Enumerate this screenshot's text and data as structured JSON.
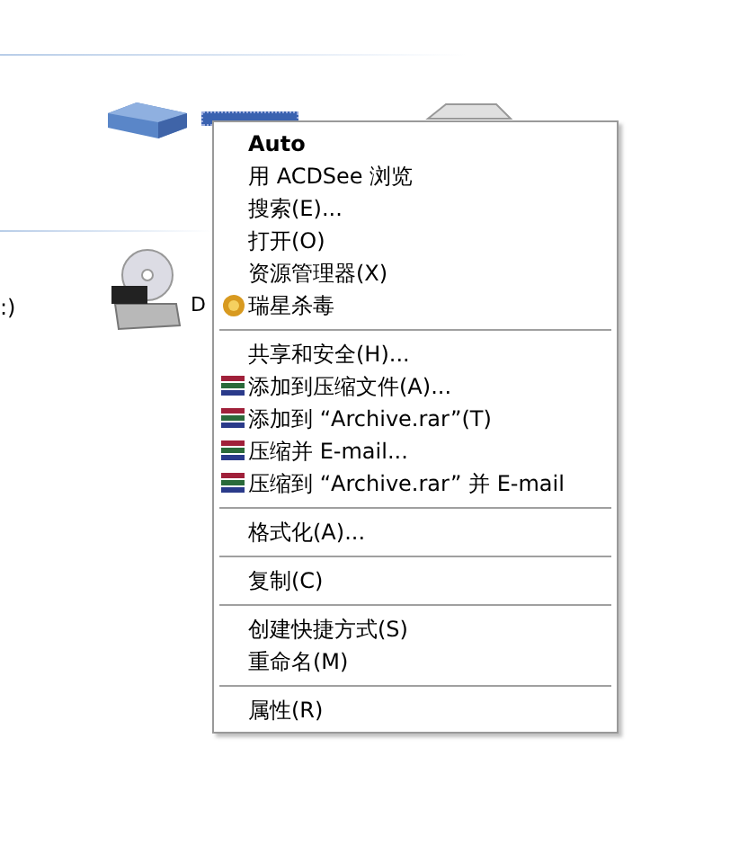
{
  "dvd_label": "D",
  "left_label": ":)",
  "context_menu": {
    "items": [
      {
        "kind": "default",
        "label": "Auto"
      },
      {
        "kind": "plain",
        "label": "用 ACDSee 浏览"
      },
      {
        "kind": "plain",
        "label": "搜索(E)..."
      },
      {
        "kind": "plain",
        "label": "打开(O)"
      },
      {
        "kind": "plain",
        "label": "资源管理器(X)"
      },
      {
        "kind": "antivirus",
        "label": "瑞星杀毒"
      },
      {
        "kind": "separator"
      },
      {
        "kind": "plain",
        "label": "共享和安全(H)..."
      },
      {
        "kind": "archive",
        "label": "添加到压缩文件(A)..."
      },
      {
        "kind": "archive",
        "label": "添加到 “Archive.rar”(T)"
      },
      {
        "kind": "archive",
        "label": "压缩并 E-mail..."
      },
      {
        "kind": "archive",
        "label": "压缩到 “Archive.rar” 并 E-mail"
      },
      {
        "kind": "separator"
      },
      {
        "kind": "plain",
        "label": "格式化(A)..."
      },
      {
        "kind": "separator"
      },
      {
        "kind": "plain",
        "label": "复制(C)"
      },
      {
        "kind": "separator"
      },
      {
        "kind": "plain",
        "label": "创建快捷方式(S)"
      },
      {
        "kind": "plain",
        "label": "重命名(M)"
      },
      {
        "kind": "separator"
      },
      {
        "kind": "plain",
        "label": "属性(R)"
      }
    ]
  }
}
